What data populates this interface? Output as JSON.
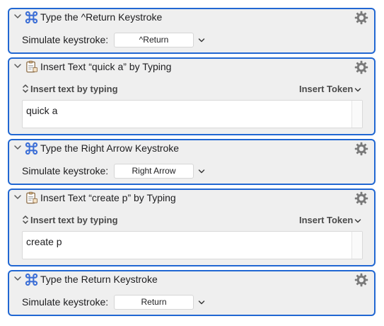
{
  "actions": [
    {
      "kind": "keystroke",
      "title": "Type the ^Return Keystroke",
      "simulate_label": "Simulate keystroke:",
      "keystroke": "^Return"
    },
    {
      "kind": "insert",
      "title": "Insert Text “quick a” by Typing",
      "mode_label": "Insert text by typing",
      "token_label": "Insert Token",
      "text": "quick a"
    },
    {
      "kind": "keystroke",
      "title": "Type the Right Arrow Keystroke",
      "simulate_label": "Simulate keystroke:",
      "keystroke": "Right Arrow"
    },
    {
      "kind": "insert",
      "title": "Insert Text “create p” by Typing",
      "mode_label": "Insert text by typing",
      "token_label": "Insert Token",
      "text": "create p"
    },
    {
      "kind": "keystroke",
      "title": "Type the Return Keystroke",
      "simulate_label": "Simulate keystroke:",
      "keystroke": "Return"
    }
  ],
  "icons": {
    "collapse": "chevron-down-icon",
    "keystroke_action": "command-key-icon",
    "insert_action": "clipboard-text-icon",
    "settings": "gear-icon",
    "mode_popup": "up-down-arrows-icon"
  },
  "colors": {
    "selection_border": "#2167d2",
    "action_background": "#efefef",
    "command_icon": "#3d6fd6",
    "gear": "#7a7a7a"
  }
}
